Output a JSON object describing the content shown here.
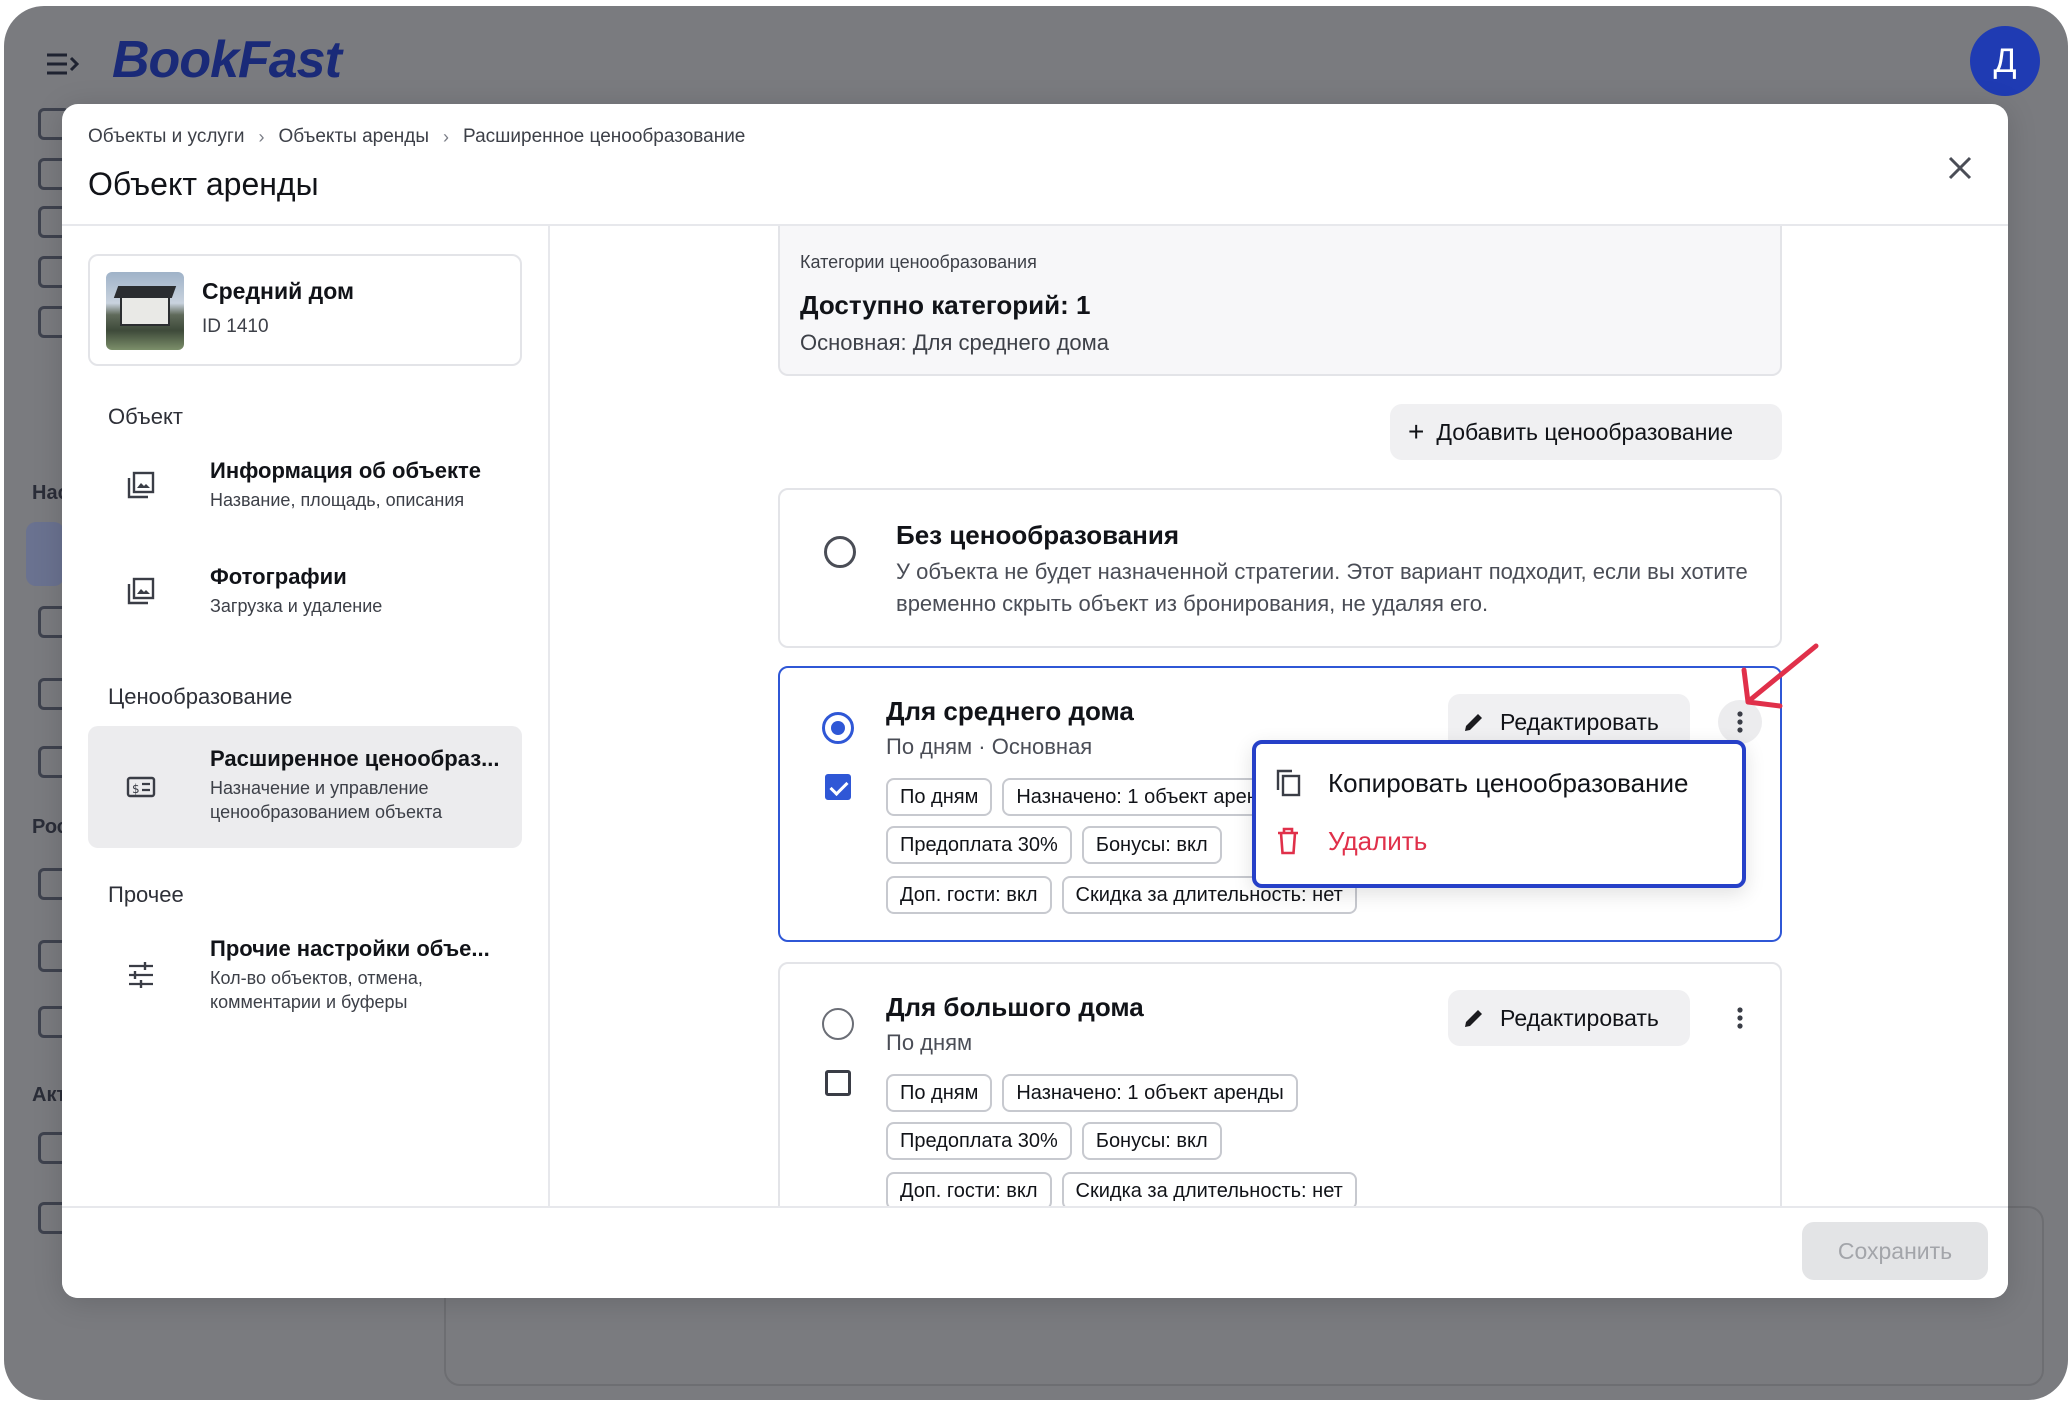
{
  "app": {
    "logo": "BookFast",
    "avatar_letter": "Д",
    "rail_labels": [
      "Нас",
      "Рос",
      "Акт"
    ]
  },
  "modal": {
    "breadcrumb": [
      "Объекты и услуги",
      "Объекты аренды",
      "Расширенное ценообразование"
    ],
    "title": "Объект аренды"
  },
  "sidebar": {
    "object": {
      "name": "Средний дом",
      "id": "ID 1410"
    },
    "sections": [
      {
        "title": "Объект"
      },
      {
        "title": "Ценообразование"
      },
      {
        "title": "Прочее"
      }
    ],
    "items": [
      {
        "title": "Информация об объекте",
        "sub": "Название, площадь, описания",
        "icon": "image-icon"
      },
      {
        "title": "Фотографии",
        "sub": "Загрузка и удаление",
        "icon": "image-icon"
      },
      {
        "title": "Расширенное ценообраз...",
        "sub": "Назначение и управление ценообразованием объекта",
        "icon": "price-tag-icon",
        "active": true
      },
      {
        "title": "Прочие настройки объе...",
        "sub": "Кол-во объектов, отмена, комментарии и буферы",
        "icon": "sliders-icon"
      }
    ]
  },
  "content": {
    "categories": {
      "label": "Категории ценообразования",
      "count": "Доступно категорий: 1",
      "main": "Основная: Для среднего дома"
    },
    "add_button": "Добавить ценообразование",
    "no_pricing": {
      "title": "Без ценообразования",
      "desc": "У объекта не будет назначенной стратегии. Этот вариант подходит, если вы хотите временно скрыть объект из бронирования, не удаляя его."
    },
    "cards": [
      {
        "title": "Для среднего дома",
        "sub": "По дням · Основная",
        "edit": "Редактировать",
        "selected": true,
        "checked": true,
        "chips_row1": [
          "По дням",
          "Назначено: 1 объект аренды"
        ],
        "chips_row2": [
          "Предоплата 30%",
          "Бонусы: вкл"
        ],
        "chips_row3": [
          "Доп. гости: вкл",
          "Скидка за длительность: нет"
        ]
      },
      {
        "title": "Для большого дома",
        "sub": "По дням",
        "edit": "Редактировать",
        "selected": false,
        "checked": false,
        "chips_row1": [
          "По дням",
          "Назначено: 1 объект аренды"
        ],
        "chips_row2": [
          "Предоплата 30%",
          "Бонусы: вкл"
        ],
        "chips_row3": [
          "Доп. гости: вкл",
          "Скидка за длительность: нет"
        ]
      }
    ],
    "menu": {
      "copy": "Копировать ценообразование",
      "delete": "Удалить"
    }
  },
  "footer": {
    "save": "Сохранить"
  },
  "colors": {
    "accent": "#2f57d6",
    "danger": "#e0304a",
    "overlay": "#7a7b7f",
    "annotation_arrow": "#e0304a"
  }
}
